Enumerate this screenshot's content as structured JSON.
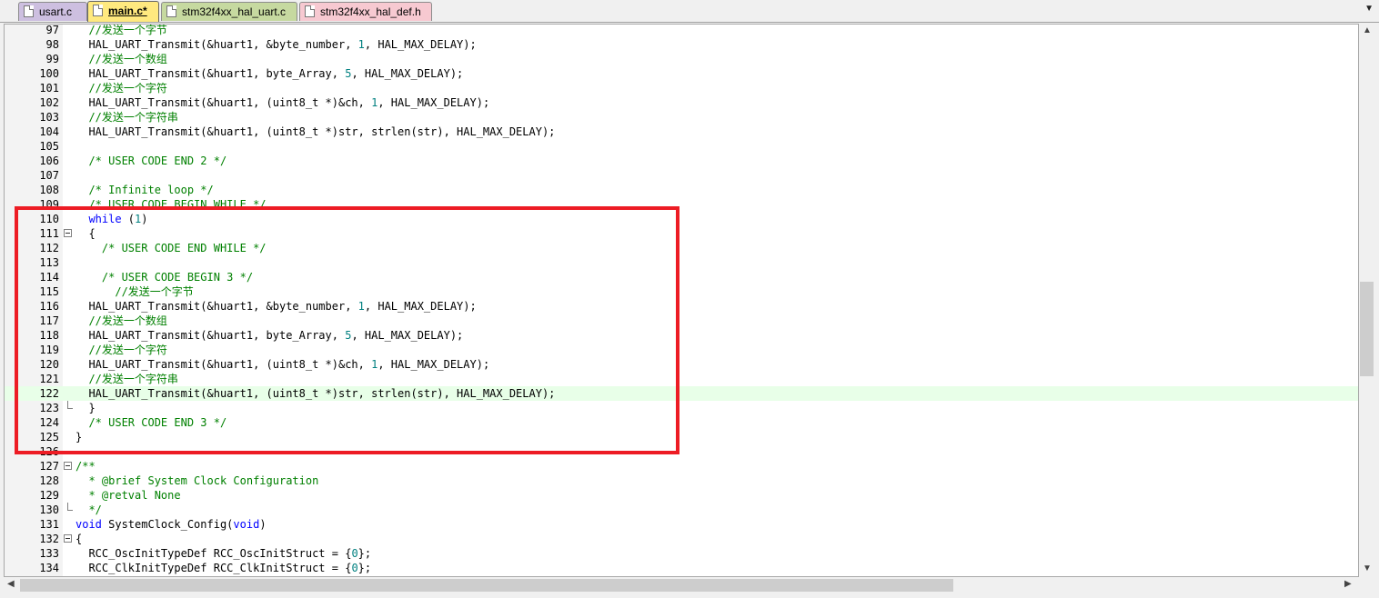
{
  "tabs": [
    {
      "label": "usart.c",
      "bg": "#cdbfe0",
      "icon": "c-file-icon"
    },
    {
      "label": "main.c*",
      "bg": "#ffe97f",
      "icon": "c-file-icon"
    },
    {
      "label": "stm32f4xx_hal_uart.c",
      "bg": "#c6d9a0",
      "icon": "c-file-icon"
    },
    {
      "label": "stm32f4xx_hal_def.h",
      "bg": "#f7c9d1",
      "icon": "h-file-icon"
    }
  ],
  "active_tab": 1,
  "current_line": 122,
  "colors": {
    "highlight_box": "#ed1c24",
    "comment": "#008000",
    "keyword": "#0000ff",
    "number": "#008080",
    "current_line_bg": "#e8ffe8"
  },
  "lines": [
    {
      "n": "97",
      "t": "  //发送一个字节",
      "k": "cm"
    },
    {
      "n": "98",
      "t": "  HAL_UART_Transmit(&huart1, &byte_number, 1, HAL_MAX_DELAY);",
      "k": "code"
    },
    {
      "n": "99",
      "t": "  //发送一个数组",
      "k": "cm"
    },
    {
      "n": "100",
      "t": "  HAL_UART_Transmit(&huart1, byte_Array, 5, HAL_MAX_DELAY);",
      "k": "code"
    },
    {
      "n": "101",
      "t": "  //发送一个字符",
      "k": "cm"
    },
    {
      "n": "102",
      "t": "  HAL_UART_Transmit(&huart1, (uint8_t *)&ch, 1, HAL_MAX_DELAY);",
      "k": "code"
    },
    {
      "n": "103",
      "t": "  //发送一个字符串",
      "k": "cm"
    },
    {
      "n": "104",
      "t": "  HAL_UART_Transmit(&huart1, (uint8_t *)str, strlen(str), HAL_MAX_DELAY);",
      "k": "code"
    },
    {
      "n": "105",
      "t": "",
      "k": "code"
    },
    {
      "n": "106",
      "t": "  /* USER CODE END 2 */",
      "k": "cm"
    },
    {
      "n": "107",
      "t": "",
      "k": "code"
    },
    {
      "n": "108",
      "t": "  /* Infinite loop */",
      "k": "cm"
    },
    {
      "n": "109",
      "t": "  /* USER CODE BEGIN WHILE */",
      "k": "cm"
    },
    {
      "n": "110",
      "t": "  while (1)",
      "k": "code"
    },
    {
      "n": "111",
      "t": "  {",
      "k": "code",
      "f": "open"
    },
    {
      "n": "112",
      "t": "    /* USER CODE END WHILE */",
      "k": "cm"
    },
    {
      "n": "113",
      "t": "",
      "k": "code"
    },
    {
      "n": "114",
      "t": "    /* USER CODE BEGIN 3 */",
      "k": "cm"
    },
    {
      "n": "115",
      "t": "      //发送一个字节",
      "k": "cm"
    },
    {
      "n": "116",
      "t": "  HAL_UART_Transmit(&huart1, &byte_number, 1, HAL_MAX_DELAY);",
      "k": "code"
    },
    {
      "n": "117",
      "t": "  //发送一个数组",
      "k": "cm"
    },
    {
      "n": "118",
      "t": "  HAL_UART_Transmit(&huart1, byte_Array, 5, HAL_MAX_DELAY);",
      "k": "code"
    },
    {
      "n": "119",
      "t": "  //发送一个字符",
      "k": "cm"
    },
    {
      "n": "120",
      "t": "  HAL_UART_Transmit(&huart1, (uint8_t *)&ch, 1, HAL_MAX_DELAY);",
      "k": "code"
    },
    {
      "n": "121",
      "t": "  //发送一个字符串",
      "k": "cm"
    },
    {
      "n": "122",
      "t": "  HAL_UART_Transmit(&huart1, (uint8_t *)str, strlen(str), HAL_MAX_DELAY);",
      "k": "code"
    },
    {
      "n": "123",
      "t": "  }",
      "k": "code",
      "f": "end"
    },
    {
      "n": "124",
      "t": "  /* USER CODE END 3 */",
      "k": "cm"
    },
    {
      "n": "125",
      "t": "}",
      "k": "code"
    },
    {
      "n": "126",
      "t": "",
      "k": "code"
    },
    {
      "n": "127",
      "t": "/**",
      "k": "cm",
      "f": "open"
    },
    {
      "n": "128",
      "t": "  * @brief System Clock Configuration",
      "k": "cm"
    },
    {
      "n": "129",
      "t": "  * @retval None",
      "k": "cm"
    },
    {
      "n": "130",
      "t": "  */",
      "k": "cm",
      "f": "end"
    },
    {
      "n": "131",
      "t": "void SystemClock_Config(void)",
      "k": "code"
    },
    {
      "n": "132",
      "t": "{",
      "k": "code",
      "f": "open"
    },
    {
      "n": "133",
      "t": "  RCC_OscInitTypeDef RCC_OscInitStruct = {0};",
      "k": "code"
    },
    {
      "n": "134",
      "t": "  RCC_ClkInitTypeDef RCC_ClkInitStruct = {0};",
      "k": "code"
    }
  ]
}
